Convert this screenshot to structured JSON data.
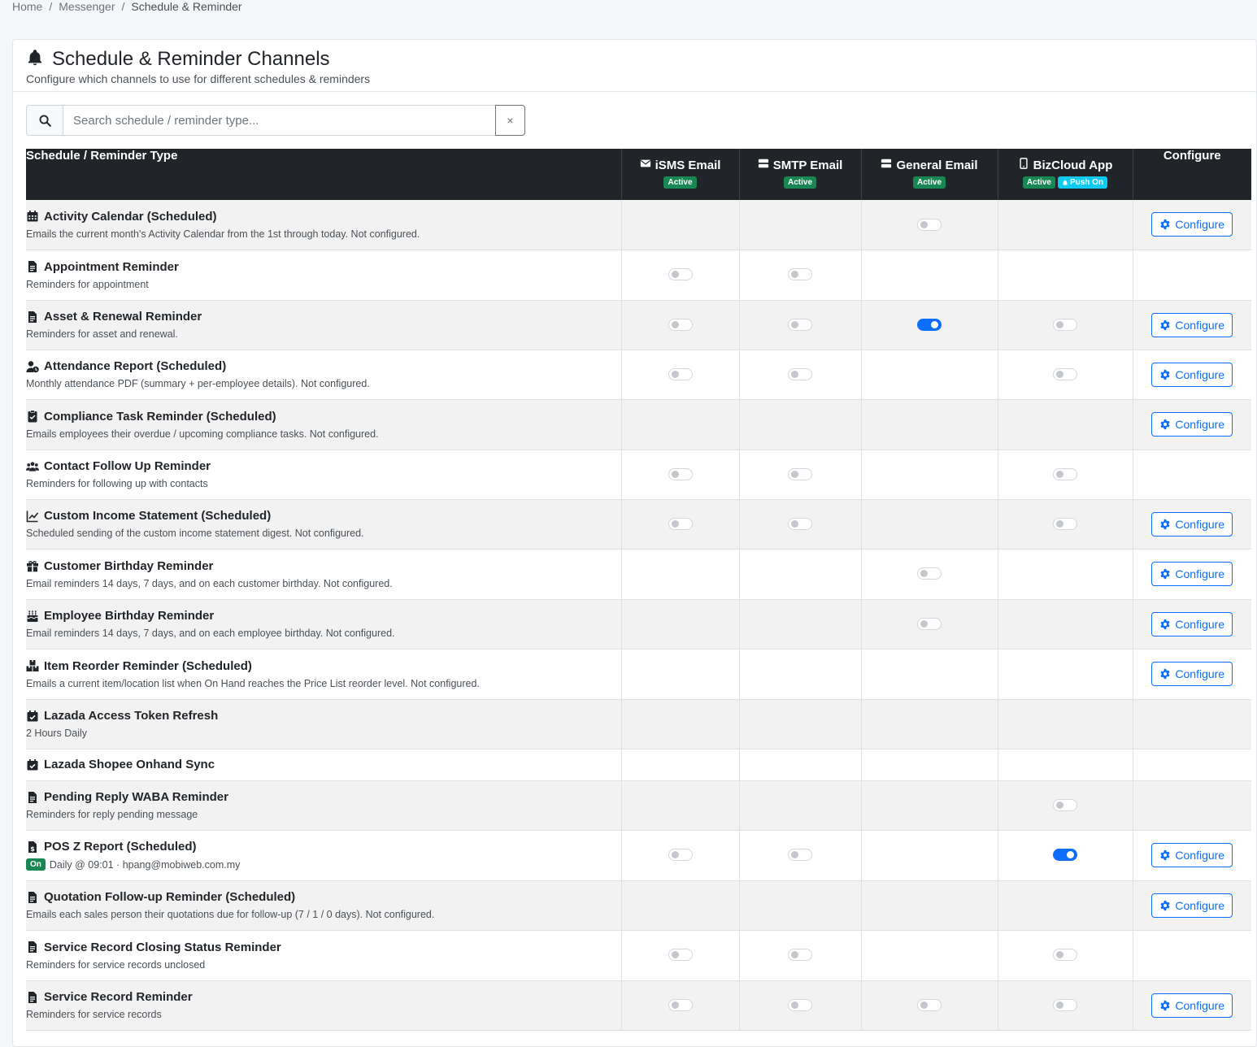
{
  "breadcrumb": {
    "items": [
      "Home",
      "Messenger",
      "Schedule & Reminder"
    ],
    "separator": "/"
  },
  "page": {
    "title": "Schedule & Reminder Channels",
    "subtitle": "Configure which channels to use for different schedules & reminders",
    "title_icon": "bell-icon"
  },
  "search": {
    "placeholder": "Search schedule / reminder type...",
    "value": "",
    "clear_label": "×"
  },
  "table": {
    "type_header": "Schedule / Reminder Type",
    "configure_header": "Configure",
    "channels": [
      {
        "key": "isms",
        "name": "iSMS Email",
        "icon": "envelope-icon",
        "badges": [
          "Active"
        ]
      },
      {
        "key": "smtp",
        "name": "SMTP Email",
        "icon": "server-icon",
        "badges": [
          "Active"
        ]
      },
      {
        "key": "general",
        "name": "General Email",
        "icon": "server-icon",
        "badges": [
          "Active"
        ]
      },
      {
        "key": "bizcloud",
        "name": "BizCloud App",
        "icon": "mobile-icon",
        "badges": [
          "Active"
        ],
        "push_badge": "Push On"
      }
    ],
    "configure_label": "Configure",
    "rows": [
      {
        "title": "Activity Calendar (Scheduled)",
        "icon": "calendar-icon",
        "desc": "Emails the current month's Activity Calendar from the 1st through today. Not configured.",
        "toggles": [
          null,
          null,
          false,
          null
        ],
        "configure": true
      },
      {
        "title": "Appointment Reminder",
        "icon": "file-icon",
        "desc": "Reminders for appointment",
        "toggles": [
          false,
          false,
          null,
          null
        ],
        "configure": false
      },
      {
        "title": "Asset & Renewal Reminder",
        "icon": "file-icon",
        "desc": "Reminders for asset and renewal.",
        "toggles": [
          false,
          false,
          true,
          false
        ],
        "configure": true
      },
      {
        "title": "Attendance Report (Scheduled)",
        "icon": "user-clock-icon",
        "desc": "Monthly attendance PDF (summary + per-employee details). Not configured.",
        "toggles": [
          false,
          false,
          null,
          false
        ],
        "configure": true
      },
      {
        "title": "Compliance Task Reminder (Scheduled)",
        "icon": "clipboard-check-icon",
        "desc": "Emails employees their overdue / upcoming compliance tasks. Not configured.",
        "toggles": [
          null,
          null,
          null,
          null
        ],
        "configure": true
      },
      {
        "title": "Contact Follow Up Reminder",
        "icon": "users-icon",
        "desc": "Reminders for following up with contacts",
        "toggles": [
          false,
          false,
          null,
          false
        ],
        "configure": false
      },
      {
        "title": "Custom Income Statement (Scheduled)",
        "icon": "chart-line-icon",
        "desc": "Scheduled sending of the custom income statement digest. Not configured.",
        "toggles": [
          false,
          false,
          null,
          false
        ],
        "configure": true
      },
      {
        "title": "Customer Birthday Reminder",
        "icon": "gift-icon",
        "desc": "Email reminders 14 days, 7 days, and on each customer birthday. Not configured.",
        "toggles": [
          null,
          null,
          false,
          null
        ],
        "configure": true
      },
      {
        "title": "Employee Birthday Reminder",
        "icon": "cake-icon",
        "desc": "Email reminders 14 days, 7 days, and on each employee birthday. Not configured.",
        "toggles": [
          null,
          null,
          false,
          null
        ],
        "configure": true
      },
      {
        "title": "Item Reorder Reminder (Scheduled)",
        "icon": "boxes-icon",
        "desc": "Emails a current item/location list when On Hand reaches the Price List reorder level. Not configured.",
        "toggles": [
          null,
          null,
          null,
          null
        ],
        "configure": true
      },
      {
        "title": "Lazada Access Token Refresh",
        "icon": "calendar-check-icon",
        "desc": "2 Hours Daily",
        "toggles": [
          null,
          null,
          null,
          null
        ],
        "configure": false
      },
      {
        "title": "Lazada Shopee Onhand Sync",
        "icon": "calendar-check-icon",
        "desc": "",
        "toggles": [
          null,
          null,
          null,
          null
        ],
        "configure": false
      },
      {
        "title": "Pending Reply WABA Reminder",
        "icon": "file-icon",
        "desc": "Reminders for reply pending message",
        "toggles": [
          null,
          null,
          null,
          false
        ],
        "configure": false
      },
      {
        "title": "POS Z Report (Scheduled)",
        "icon": "file-invoice-icon",
        "desc": "Daily @ 09:01 · hpang@mobiweb.com.my",
        "status_badge": "On",
        "toggles": [
          false,
          false,
          null,
          true
        ],
        "configure": true
      },
      {
        "title": "Quotation Follow-up Reminder (Scheduled)",
        "icon": "file-icon",
        "desc": "Emails each sales person their quotations due for follow-up (7 / 1 / 0 days). Not configured.",
        "toggles": [
          null,
          null,
          null,
          null
        ],
        "configure": true
      },
      {
        "title": "Service Record Closing Status Reminder",
        "icon": "file-icon",
        "desc": "Reminders for service records unclosed",
        "toggles": [
          false,
          false,
          null,
          false
        ],
        "configure": false
      },
      {
        "title": "Service Record Reminder",
        "icon": "file-icon",
        "desc": "Reminders for service records",
        "toggles": [
          false,
          false,
          false,
          false
        ],
        "configure": true
      }
    ]
  },
  "colors": {
    "accent": "#0d6efd",
    "header_bg": "#212529",
    "active_badge": "#198754",
    "push_badge": "#0dcaf0"
  }
}
